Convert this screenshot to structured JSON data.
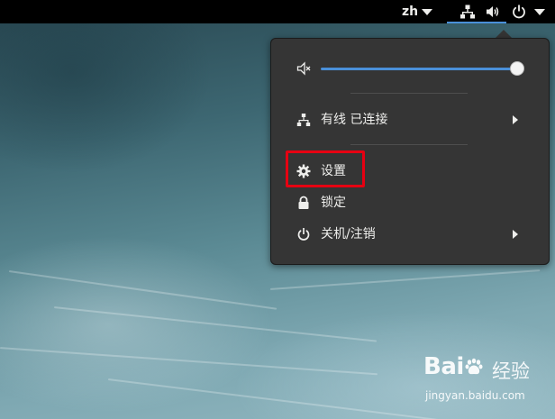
{
  "topbar": {
    "language": "zh",
    "icons": [
      "network-wired-icon",
      "volume-high-icon",
      "power-icon"
    ],
    "active_underline_color": "#4a90d9"
  },
  "menu": {
    "volume": {
      "icon": "volume-muted-icon",
      "level": 1.0
    },
    "items": [
      {
        "icon": "network-wired-icon",
        "label": "有线 已连接",
        "has_submenu": true
      },
      {
        "icon": "gear-icon",
        "label": "设置",
        "has_submenu": false,
        "highlighted": true
      },
      {
        "icon": "lock-icon",
        "label": "锁定",
        "has_submenu": false
      },
      {
        "icon": "power-icon",
        "label": "关机/注销",
        "has_submenu": true
      }
    ],
    "highlight_color": "#e60012",
    "background_color": "#353535",
    "accent_color": "#4a90d9"
  },
  "watermark": {
    "logo": "Bai",
    "logo_suffix": "经验",
    "url": "jingyan.baidu.com"
  }
}
